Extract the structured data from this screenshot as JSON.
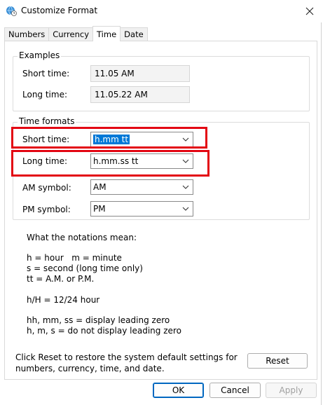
{
  "window": {
    "title": "Customize Format"
  },
  "tabs": [
    {
      "label": "Numbers",
      "active": false
    },
    {
      "label": "Currency",
      "active": false
    },
    {
      "label": "Time",
      "active": true
    },
    {
      "label": "Date",
      "active": false
    }
  ],
  "examples": {
    "group_label": "Examples",
    "short_time_label": "Short time:",
    "short_time_value": "11.05 AM",
    "long_time_label": "Long time:",
    "long_time_value": "11.05.22 AM"
  },
  "time_formats": {
    "group_label": "Time formats",
    "short_time_label": "Short time:",
    "short_time_value": "h.mm tt",
    "long_time_label": "Long time:",
    "long_time_value": "h.mm.ss tt",
    "am_label": "AM symbol:",
    "am_value": "AM",
    "pm_label": "PM symbol:",
    "pm_value": "PM"
  },
  "notations": {
    "heading": "What the notations mean:",
    "line1": "h = hour   m = minute",
    "line2": "s = second (long time only)",
    "line3": "tt = A.M. or P.M.",
    "line4": "h/H = 12/24 hour",
    "line5": "hh, mm, ss = display leading zero",
    "line6": "h, m, s = do not display leading zero"
  },
  "footer": {
    "reset_text_line1": "Click Reset to restore the system default settings for",
    "reset_text_line2": "numbers, currency, time, and date.",
    "reset_label": "Reset",
    "ok_label": "OK",
    "cancel_label": "Cancel",
    "apply_label": "Apply"
  },
  "colors": {
    "highlight": "#e30613",
    "selection": "#0078d7"
  },
  "icons": {
    "app": "globe-clock-icon",
    "close": "close-icon",
    "dropdown": "chevron-down-icon"
  }
}
